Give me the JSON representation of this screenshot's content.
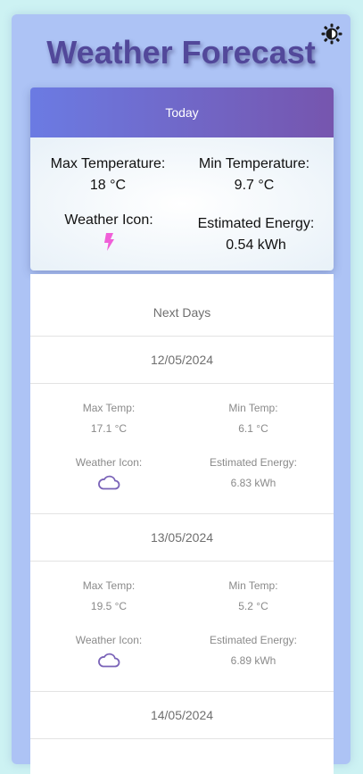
{
  "header": {
    "title": "Weather Forecast",
    "theme_toggle_icon": "half-circle-sun-icon"
  },
  "today": {
    "header": "Today",
    "max_label": "Max Temperature:",
    "max_value": "18 °C",
    "min_label": "Min Temperature:",
    "min_value": "9.7 °C",
    "icon_label": "Weather Icon:",
    "icon": "lightning-icon",
    "icon_color": "#f05fd8",
    "energy_label": "Estimated Energy:",
    "energy_value": "0.54 kWh"
  },
  "next_days": {
    "title": "Next Days",
    "days": [
      {
        "date": "12/05/2024",
        "max_label": "Max Temp:",
        "max_value": "17.1 °C",
        "min_label": "Min Temp:",
        "min_value": "6.1 °C",
        "icon_label": "Weather Icon:",
        "icon": "cloud-icon",
        "energy_label": "Estimated Energy:",
        "energy_value": "6.83 kWh"
      },
      {
        "date": "13/05/2024",
        "max_label": "Max Temp:",
        "max_value": "19.5 °C",
        "min_label": "Min Temp:",
        "min_value": "5.2 °C",
        "icon_label": "Weather Icon:",
        "icon": "cloud-icon",
        "energy_label": "Estimated Energy:",
        "energy_value": "6.89 kWh"
      },
      {
        "date": "14/05/2024"
      }
    ]
  },
  "colors": {
    "background": "#cdf2f3",
    "app_panel": "#adc3f5",
    "title": "#52489a",
    "today_gradient_start": "#6b7be3",
    "today_gradient_end": "#7655ae",
    "cloud_icon": "#7a63b8"
  }
}
